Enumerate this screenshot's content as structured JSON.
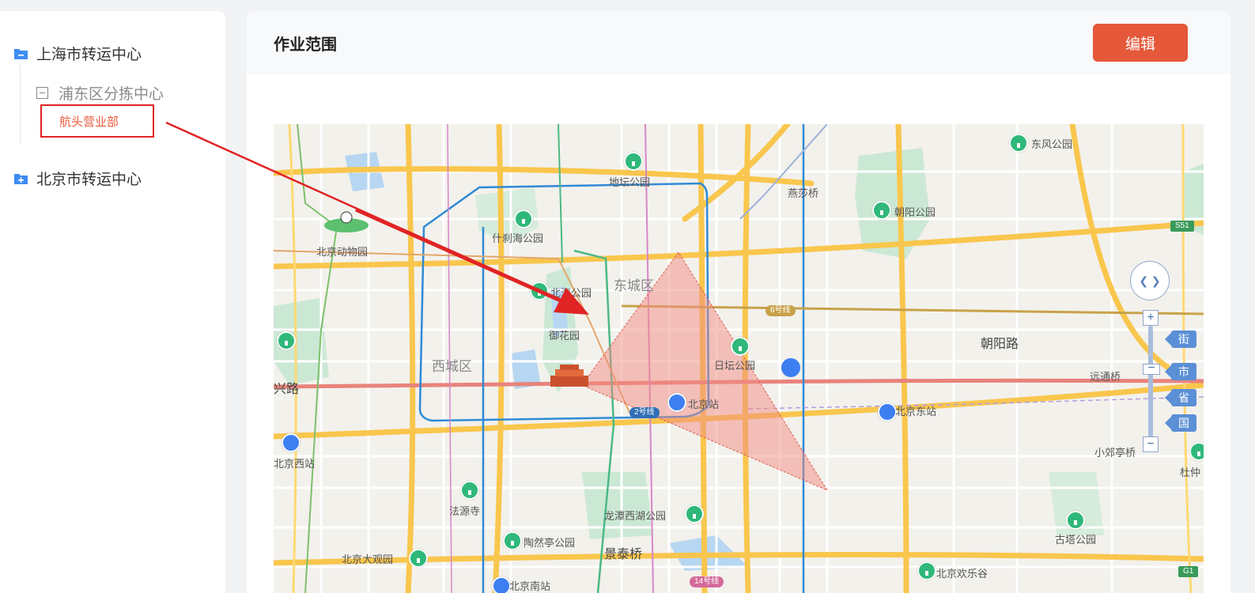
{
  "sidebar": {
    "tree": [
      {
        "label": "上海市转运中心"
      },
      {
        "label": "浦东区分拣中心"
      },
      {
        "label": "航头营业部",
        "selected": true
      },
      {
        "label": "北京市转运中心"
      }
    ]
  },
  "main": {
    "title": "作业范围",
    "edit_label": "编辑"
  },
  "map": {
    "labels": {
      "ditan": "地坛公园",
      "yanshaqiao": "燕莎桥",
      "dongfeng": "东风公园",
      "chaoyang_park": "朝阳公园",
      "shichahai": "什刹海公园",
      "beijing_zoo": "北京动物园",
      "beihai": "北海公园",
      "dongcheng": "东城区",
      "yuhuayuan": "御花园",
      "xicheng": "西城区",
      "ritan": "日坛公园",
      "chaoyang_road": "朝阳路",
      "yuantong": "远通桥",
      "xinglu": "兴路",
      "beijing_station": "北京站",
      "beijing_east": "北京东站",
      "beijing_west": "北京西站",
      "xiaojiaoting": "小郊亭桥",
      "dushe": "杜仲",
      "fayuansi": "法源寺",
      "longtan": "龙潭西湖公园",
      "taoranting": "陶然亭公园",
      "jingtai": "景泰桥",
      "daguanyuan": "北京大观园",
      "gutayuan": "古塔公园",
      "huanlegu": "北京欢乐谷",
      "beijing_south": "北京南站"
    },
    "badges": {
      "line6": "6号线",
      "line2": "2号线",
      "line14": "14号线",
      "s51": "S51",
      "g1": "G1"
    },
    "zoom_levels": [
      "街",
      "市",
      "省",
      "国"
    ],
    "colors": {
      "arterial": "#f9c64d",
      "metro_blue": "#2f8ad6",
      "metro_green": "#4cb884",
      "range_fill": "#f28b82"
    }
  }
}
